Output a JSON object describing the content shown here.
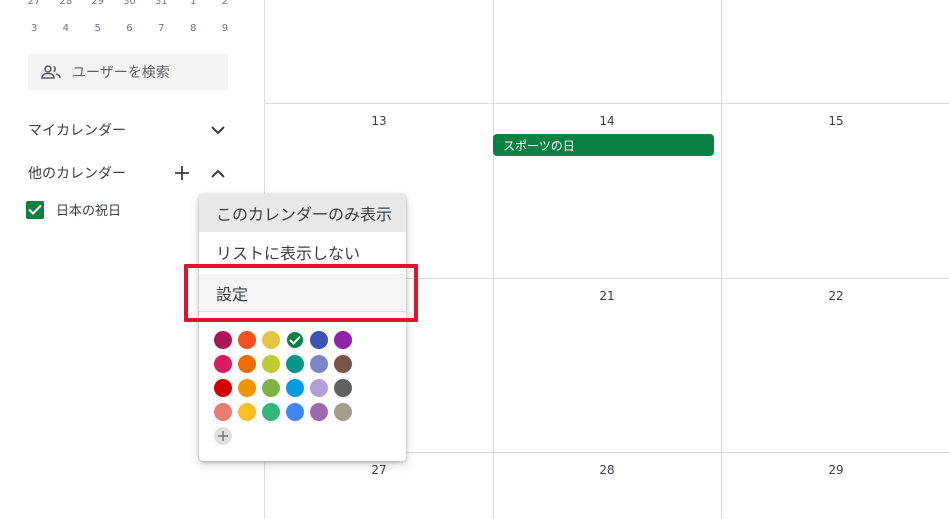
{
  "mini_calendar": {
    "row1": [
      "27",
      "28",
      "29",
      "30",
      "31",
      "1",
      "2"
    ],
    "row2": [
      "3",
      "4",
      "5",
      "6",
      "7",
      "8",
      "9"
    ]
  },
  "sidebar": {
    "search_users_label": "ユーザーを検索",
    "my_calendars_label": "マイカレンダー",
    "other_calendars_label": "他のカレンダー",
    "calendar_item_label": "日本の祝日"
  },
  "grid": {
    "row2_days": [
      "13",
      "14",
      "15"
    ],
    "row3_days": [
      "21",
      "22"
    ],
    "row4_days": [
      "27",
      "28",
      "29"
    ],
    "event_label": "スポーツの日"
  },
  "menu": {
    "item_display_only": "このカレンダーのみ表示",
    "item_hide_from_list": "リストに表示しない",
    "item_settings": "設定"
  },
  "colors": {
    "accent_green": "#0b8043",
    "highlight_red": "#e8102e",
    "palette": [
      [
        "#ad1457",
        "#f4511e",
        "#e4c441",
        "#0b8043",
        "#3f51b5",
        "#8e24aa"
      ],
      [
        "#d81b60",
        "#ef6c00",
        "#c0ca33",
        "#009688",
        "#7986cb",
        "#795548"
      ],
      [
        "#d50000",
        "#f09300",
        "#7cb342",
        "#039be5",
        "#b39ddb",
        "#616161"
      ],
      [
        "#e67c73",
        "#f6bf26",
        "#33b679",
        "#4285f4",
        "#9e69af",
        "#a79b8e"
      ]
    ]
  },
  "icons": {
    "search_users": "people-icon",
    "expand": "chevron-down-icon",
    "collapse": "chevron-up-icon",
    "add": "plus-icon",
    "check": "check-icon"
  }
}
